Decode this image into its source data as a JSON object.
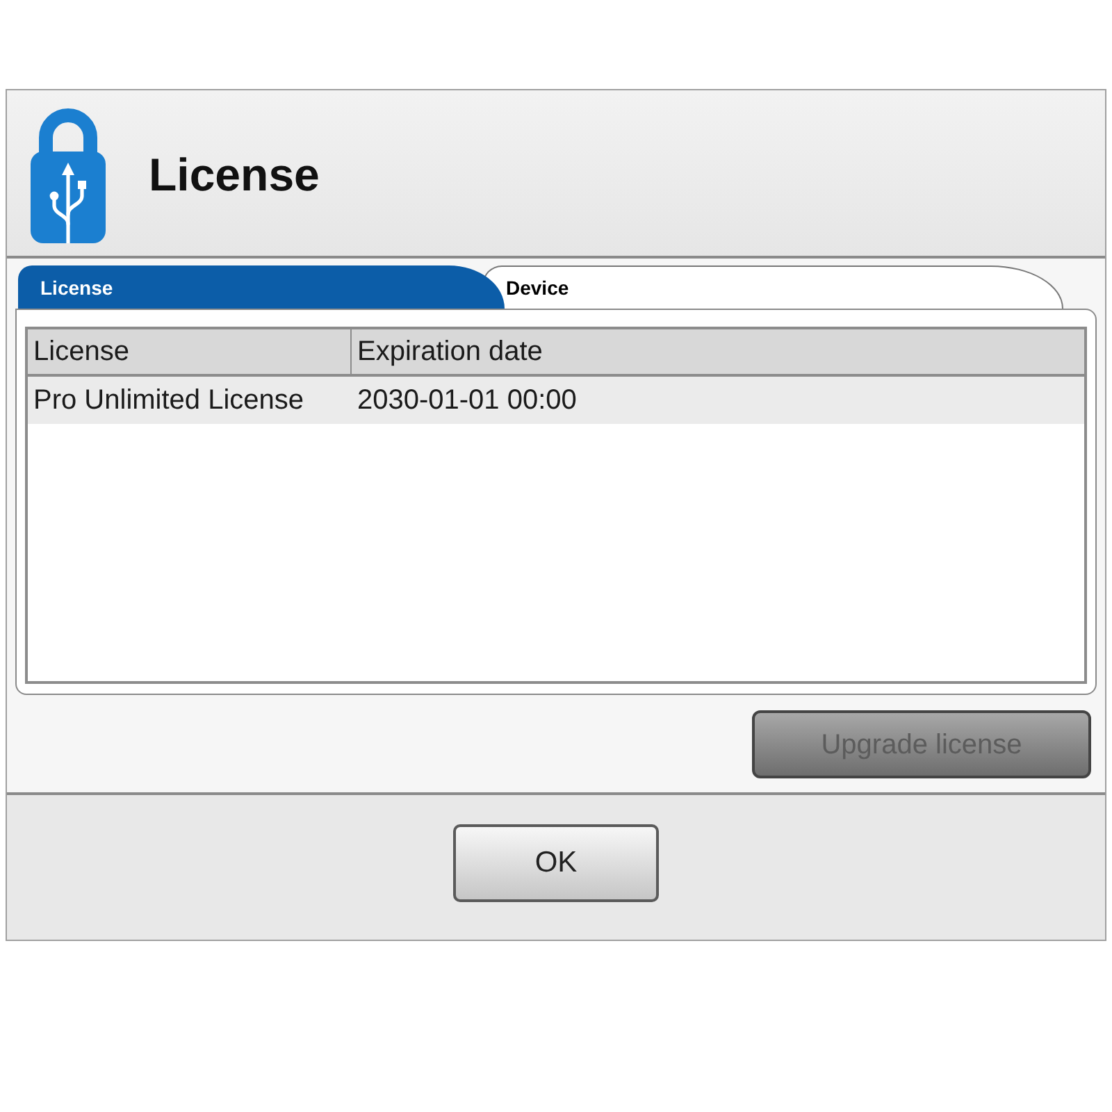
{
  "window": {
    "title": "License"
  },
  "tabs": [
    {
      "label": "License",
      "selected": true
    },
    {
      "label": "Device",
      "selected": false
    }
  ],
  "table": {
    "columns": [
      "License",
      "Expiration date"
    ],
    "rows": [
      {
        "cells": [
          "Pro Unlimited License",
          "2030-01-01 00:00"
        ]
      }
    ]
  },
  "upgrade_button": {
    "label": "Upgrade license",
    "disabled": true
  },
  "ok_button": {
    "label": "OK"
  }
}
